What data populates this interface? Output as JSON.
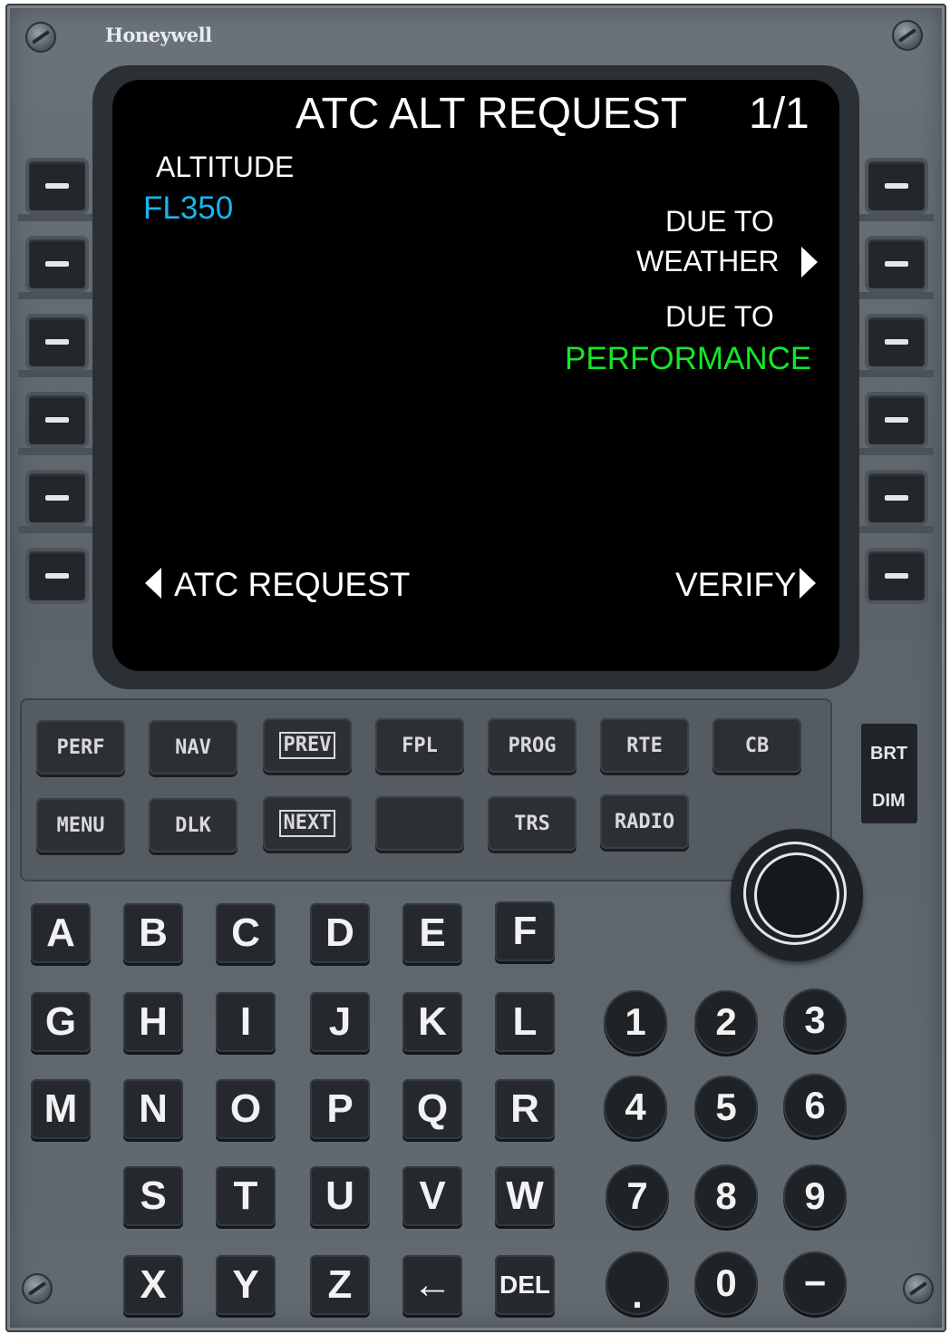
{
  "brand": "Honeywell",
  "screen": {
    "title": "ATC ALT REQUEST",
    "page": "1/1",
    "l1_label": "ALTITUDE",
    "l1_value": "FL350",
    "r2_label": "DUE TO",
    "r2_value": "WEATHER",
    "r3_label": "DUE TO",
    "r3_value": "PERFORMANCE",
    "l6": "ATC REQUEST",
    "r6": "VERIFY"
  },
  "colors": {
    "cyan": "#19b4f0",
    "green": "#17e62a",
    "white": "#ffffff"
  },
  "function_keys": {
    "perf": "PERF",
    "nav": "NAV",
    "prev": "PREV",
    "fpl": "FPL",
    "prog": "PROG",
    "rte": "RTE",
    "cb": "CB",
    "menu": "MENU",
    "dlk": "DLK",
    "next": "NEXT",
    "trs": "TRS",
    "radio": "RADIO"
  },
  "brt": "BRT",
  "dim": "DIM",
  "alpha": [
    "A",
    "B",
    "C",
    "D",
    "E",
    "F",
    "G",
    "H",
    "I",
    "J",
    "K",
    "L",
    "M",
    "N",
    "O",
    "P",
    "Q",
    "R",
    "S",
    "T",
    "U",
    "V",
    "W",
    "X",
    "Y",
    "Z",
    "←",
    "DEL"
  ],
  "numeric": [
    "1",
    "2",
    "3",
    "4",
    "5",
    "6",
    "7",
    "8",
    "9",
    ".",
    "0",
    "−"
  ]
}
